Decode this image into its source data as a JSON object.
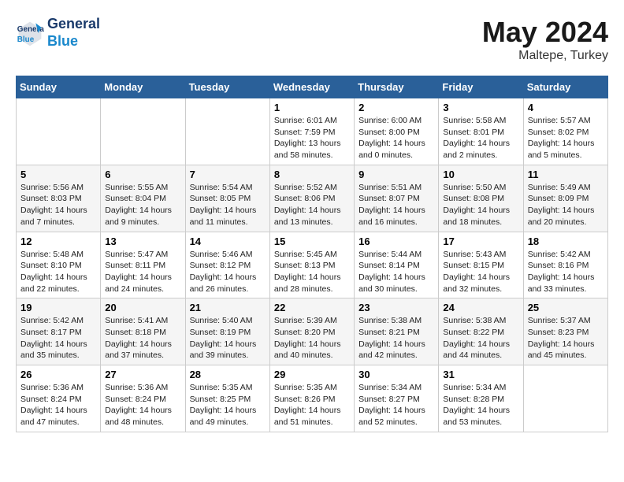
{
  "header": {
    "logo_line1": "General",
    "logo_line2": "Blue",
    "title": "May 2024",
    "location": "Maltepe, Turkey"
  },
  "weekdays": [
    "Sunday",
    "Monday",
    "Tuesday",
    "Wednesday",
    "Thursday",
    "Friday",
    "Saturday"
  ],
  "weeks": [
    [
      {
        "day": "",
        "info": ""
      },
      {
        "day": "",
        "info": ""
      },
      {
        "day": "",
        "info": ""
      },
      {
        "day": "1",
        "info": "Sunrise: 6:01 AM\nSunset: 7:59 PM\nDaylight: 13 hours\nand 58 minutes."
      },
      {
        "day": "2",
        "info": "Sunrise: 6:00 AM\nSunset: 8:00 PM\nDaylight: 14 hours\nand 0 minutes."
      },
      {
        "day": "3",
        "info": "Sunrise: 5:58 AM\nSunset: 8:01 PM\nDaylight: 14 hours\nand 2 minutes."
      },
      {
        "day": "4",
        "info": "Sunrise: 5:57 AM\nSunset: 8:02 PM\nDaylight: 14 hours\nand 5 minutes."
      }
    ],
    [
      {
        "day": "5",
        "info": "Sunrise: 5:56 AM\nSunset: 8:03 PM\nDaylight: 14 hours\nand 7 minutes."
      },
      {
        "day": "6",
        "info": "Sunrise: 5:55 AM\nSunset: 8:04 PM\nDaylight: 14 hours\nand 9 minutes."
      },
      {
        "day": "7",
        "info": "Sunrise: 5:54 AM\nSunset: 8:05 PM\nDaylight: 14 hours\nand 11 minutes."
      },
      {
        "day": "8",
        "info": "Sunrise: 5:52 AM\nSunset: 8:06 PM\nDaylight: 14 hours\nand 13 minutes."
      },
      {
        "day": "9",
        "info": "Sunrise: 5:51 AM\nSunset: 8:07 PM\nDaylight: 14 hours\nand 16 minutes."
      },
      {
        "day": "10",
        "info": "Sunrise: 5:50 AM\nSunset: 8:08 PM\nDaylight: 14 hours\nand 18 minutes."
      },
      {
        "day": "11",
        "info": "Sunrise: 5:49 AM\nSunset: 8:09 PM\nDaylight: 14 hours\nand 20 minutes."
      }
    ],
    [
      {
        "day": "12",
        "info": "Sunrise: 5:48 AM\nSunset: 8:10 PM\nDaylight: 14 hours\nand 22 minutes."
      },
      {
        "day": "13",
        "info": "Sunrise: 5:47 AM\nSunset: 8:11 PM\nDaylight: 14 hours\nand 24 minutes."
      },
      {
        "day": "14",
        "info": "Sunrise: 5:46 AM\nSunset: 8:12 PM\nDaylight: 14 hours\nand 26 minutes."
      },
      {
        "day": "15",
        "info": "Sunrise: 5:45 AM\nSunset: 8:13 PM\nDaylight: 14 hours\nand 28 minutes."
      },
      {
        "day": "16",
        "info": "Sunrise: 5:44 AM\nSunset: 8:14 PM\nDaylight: 14 hours\nand 30 minutes."
      },
      {
        "day": "17",
        "info": "Sunrise: 5:43 AM\nSunset: 8:15 PM\nDaylight: 14 hours\nand 32 minutes."
      },
      {
        "day": "18",
        "info": "Sunrise: 5:42 AM\nSunset: 8:16 PM\nDaylight: 14 hours\nand 33 minutes."
      }
    ],
    [
      {
        "day": "19",
        "info": "Sunrise: 5:42 AM\nSunset: 8:17 PM\nDaylight: 14 hours\nand 35 minutes."
      },
      {
        "day": "20",
        "info": "Sunrise: 5:41 AM\nSunset: 8:18 PM\nDaylight: 14 hours\nand 37 minutes."
      },
      {
        "day": "21",
        "info": "Sunrise: 5:40 AM\nSunset: 8:19 PM\nDaylight: 14 hours\nand 39 minutes."
      },
      {
        "day": "22",
        "info": "Sunrise: 5:39 AM\nSunset: 8:20 PM\nDaylight: 14 hours\nand 40 minutes."
      },
      {
        "day": "23",
        "info": "Sunrise: 5:38 AM\nSunset: 8:21 PM\nDaylight: 14 hours\nand 42 minutes."
      },
      {
        "day": "24",
        "info": "Sunrise: 5:38 AM\nSunset: 8:22 PM\nDaylight: 14 hours\nand 44 minutes."
      },
      {
        "day": "25",
        "info": "Sunrise: 5:37 AM\nSunset: 8:23 PM\nDaylight: 14 hours\nand 45 minutes."
      }
    ],
    [
      {
        "day": "26",
        "info": "Sunrise: 5:36 AM\nSunset: 8:24 PM\nDaylight: 14 hours\nand 47 minutes."
      },
      {
        "day": "27",
        "info": "Sunrise: 5:36 AM\nSunset: 8:24 PM\nDaylight: 14 hours\nand 48 minutes."
      },
      {
        "day": "28",
        "info": "Sunrise: 5:35 AM\nSunset: 8:25 PM\nDaylight: 14 hours\nand 49 minutes."
      },
      {
        "day": "29",
        "info": "Sunrise: 5:35 AM\nSunset: 8:26 PM\nDaylight: 14 hours\nand 51 minutes."
      },
      {
        "day": "30",
        "info": "Sunrise: 5:34 AM\nSunset: 8:27 PM\nDaylight: 14 hours\nand 52 minutes."
      },
      {
        "day": "31",
        "info": "Sunrise: 5:34 AM\nSunset: 8:28 PM\nDaylight: 14 hours\nand 53 minutes."
      },
      {
        "day": "",
        "info": ""
      }
    ]
  ]
}
